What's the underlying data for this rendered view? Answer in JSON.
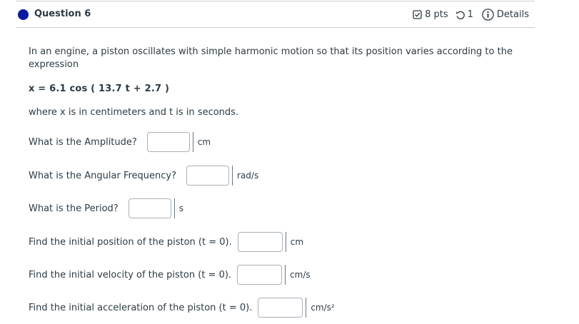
{
  "question": {
    "title": "Question 6",
    "points": "8 pts",
    "tries": "1",
    "details_label": "Details"
  },
  "body": {
    "intro": "In an engine, a piston oscillates with simple harmonic motion so that its position varies according to the expression",
    "formula": "x = 6.1 cos ( 13.7 t + 2.7 )",
    "where": "where x is in centimeters and t is in seconds."
  },
  "parts": [
    {
      "prompt": "What is the Amplitude?",
      "value": "",
      "unit": "cm"
    },
    {
      "prompt": "What is the Angular Frequency?",
      "value": "",
      "unit": "rad/s"
    },
    {
      "prompt": "What is the Period?",
      "value": "",
      "unit": "s"
    },
    {
      "prompt": "Find the initial position of the piston (t = 0).",
      "value": "",
      "unit": "cm"
    },
    {
      "prompt": "Find the initial velocity of the piston (t = 0).",
      "value": "",
      "unit": "cm/s"
    },
    {
      "prompt": "Find the initial acceleration of the piston (t = 0).",
      "value": "",
      "unit": "cm/s²"
    }
  ],
  "colors": {
    "accent": "#0a1a9e",
    "text": "#2d3b45"
  }
}
